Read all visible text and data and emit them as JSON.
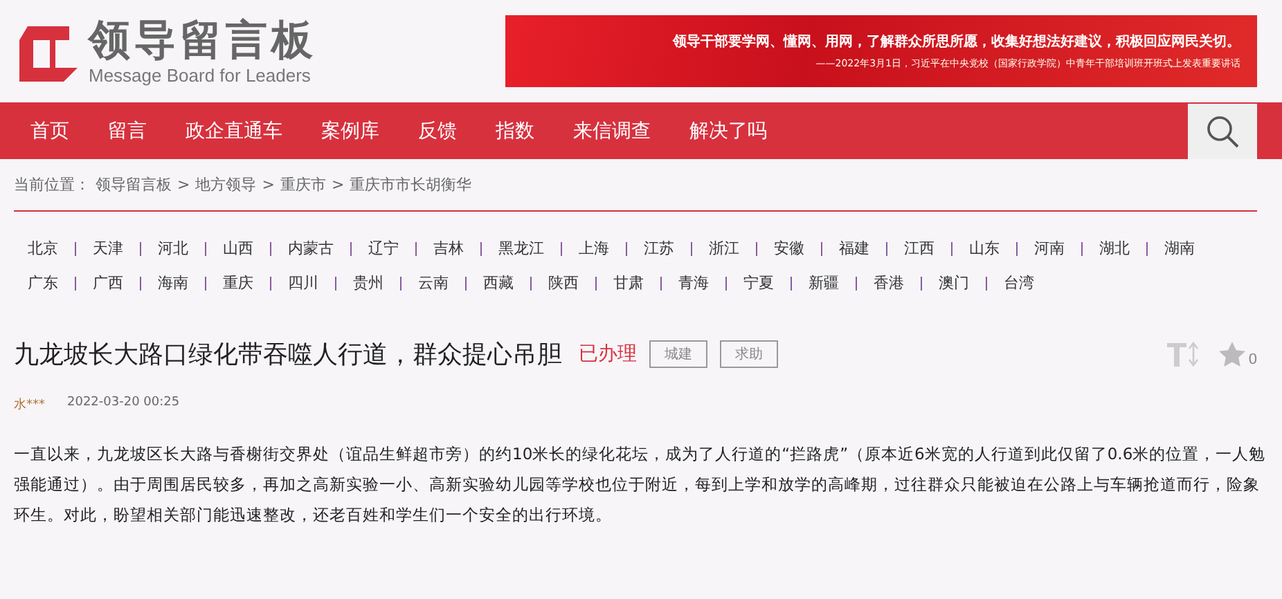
{
  "logo": {
    "title": "领导留言板",
    "subtitle": "Message Board for Leaders"
  },
  "banner": {
    "headline": "领导干部要学网、懂网、用网，了解群众所思所愿，收集好想法好建议，积极回应网民关切。",
    "source": "——2022年3月1日，习近平在中央党校（国家行政学院）中青年干部培训班开班式上发表重要讲话"
  },
  "nav": [
    "首页",
    "留言",
    "政企直通车",
    "案例库",
    "反馈",
    "指数",
    "来信调查",
    "解决了吗"
  ],
  "breadcrumb": {
    "label": "当前位置：",
    "items": [
      "领导留言板",
      "地方领导",
      "重庆市",
      "重庆市市长胡衡华"
    ],
    "separator": ">"
  },
  "province_rows": [
    [
      "北京",
      "天津",
      "河北",
      "山西",
      "内蒙古",
      "辽宁",
      "吉林",
      "黑龙江",
      "上海",
      "江苏",
      "浙江",
      "安徽",
      "福建",
      "江西",
      "山东",
      "河南",
      "湖北",
      "湖南"
    ],
    [
      "广东",
      "广西",
      "海南",
      "重庆",
      "四川",
      "贵州",
      "云南",
      "西藏",
      "陕西",
      "甘肃",
      "青海",
      "宁夏",
      "新疆",
      "香港",
      "澳门",
      "台湾"
    ]
  ],
  "message": {
    "title": "九龙坡长大路口绿化带吞噬人行道，群众提心吊胆",
    "status": "已办理",
    "tags": [
      "城建",
      "求助"
    ],
    "favorites": "0",
    "author": "水***",
    "date": "2022-03-20 00:25",
    "body": "一直以来，九龙坡区长大路与香榭街交界处（谊品生鲜超市旁）的约10米长的绿化花坛，成为了人行道的“拦路虎”（原本近6米宽的人行道到此仅留了0.6米的位置，一人勉强能通过）。由于周围居民较多，再加之高新实验一小、高新实验幼儿园等学校也位于附近，每到上学和放学的高峰期，过往群众只能被迫在公路上与车辆抢道而行，险象环生。对此，盼望相关部门能迅速整改，还老百姓和学生们一个安全的出行环境。"
  }
}
